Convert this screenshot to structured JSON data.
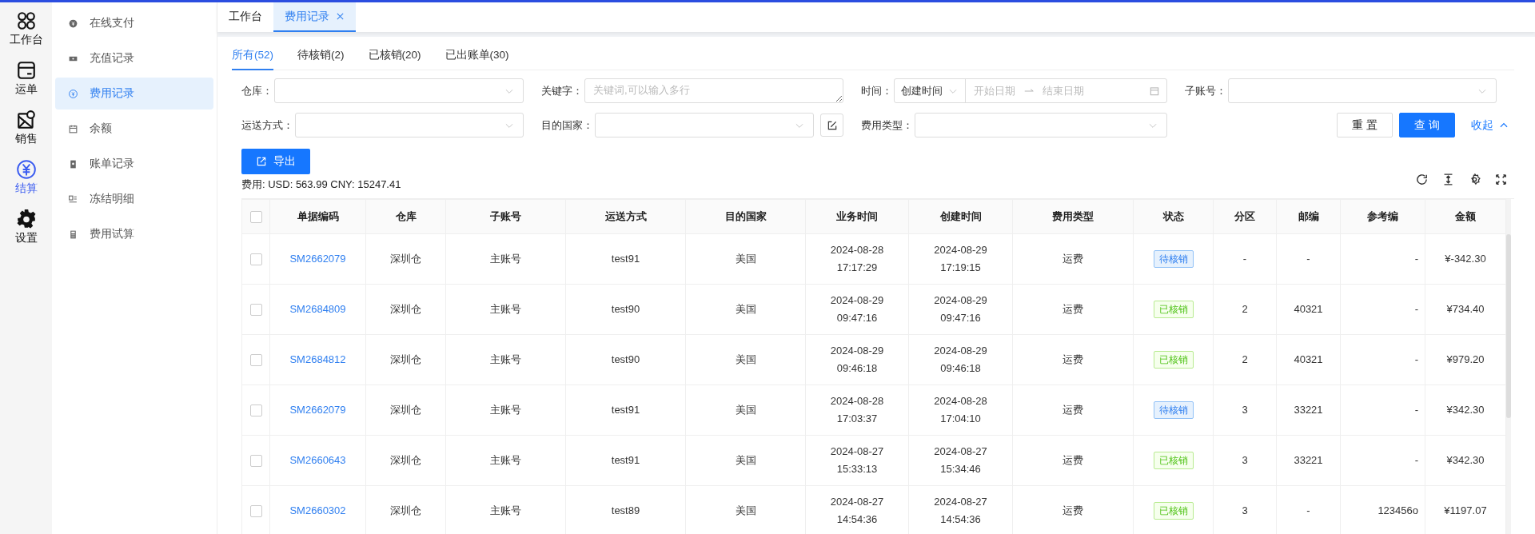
{
  "rail": {
    "items": [
      {
        "label": "工作台",
        "selected": false
      },
      {
        "label": "运单",
        "selected": false
      },
      {
        "label": "销售",
        "selected": false
      },
      {
        "label": "结算",
        "selected": true
      },
      {
        "label": "设置",
        "selected": false
      }
    ]
  },
  "submenu": {
    "items": [
      {
        "label": "在线支付",
        "selected": false
      },
      {
        "label": "充值记录",
        "selected": false
      },
      {
        "label": "费用记录",
        "selected": true
      },
      {
        "label": "余额",
        "selected": false
      },
      {
        "label": "账单记录",
        "selected": false
      },
      {
        "label": "冻结明细",
        "selected": false
      },
      {
        "label": "费用试算",
        "selected": false
      }
    ]
  },
  "page_tabs": [
    {
      "label": "工作台",
      "selected": false,
      "closable": false
    },
    {
      "label": "费用记录",
      "selected": true,
      "closable": true
    }
  ],
  "status_tabs": [
    {
      "label": "所有(52)",
      "selected": true
    },
    {
      "label": "待核销(2)",
      "selected": false
    },
    {
      "label": "已核销(20)",
      "selected": false
    },
    {
      "label": "已出账单(30)",
      "selected": false
    }
  ],
  "filters": [
    {
      "kind": "select",
      "label": "仓库："
    },
    {
      "kind": "textarea",
      "label": "关键字：",
      "placeholder": "关键词,可以输入多行"
    },
    {
      "kind": "daterange",
      "label": "时间：",
      "value": "创建时间",
      "start_placeholder": "开始日期",
      "end_placeholder": "结束日期"
    },
    {
      "kind": "select",
      "label": "子账号："
    },
    {
      "kind": "select",
      "label": "运送方式："
    },
    {
      "kind": "select_extra",
      "label": "目的国家："
    },
    {
      "kind": "select",
      "label": "费用类型："
    }
  ],
  "actions": {
    "reset": "重 置",
    "query": "查 询",
    "collapse": "收起"
  },
  "export_button": "导出",
  "summary": "费用: USD: 563.99 CNY: 15247.41",
  "table": {
    "all_checked": false,
    "columns": [
      "单据编码",
      "仓库",
      "子账号",
      "运送方式",
      "目的国家",
      "业务时间",
      "创建时间",
      "费用类型",
      "状态",
      "分区",
      "邮编",
      "参考编",
      "金额"
    ],
    "rows": [
      {
        "checked": false,
        "cells": [
          "SM2662079",
          "深圳仓",
          "主账号",
          "test91",
          "美国",
          "2024-08-28\n17:17:29",
          "2024-08-29\n17:19:15",
          "运费",
          {
            "label": "待核销",
            "kind": "pending"
          },
          "-",
          "-",
          "-",
          "¥-342.30"
        ]
      },
      {
        "checked": false,
        "cells": [
          "SM2684809",
          "深圳仓",
          "主账号",
          "test90",
          "美国",
          "2024-08-29\n09:47:16",
          "2024-08-29\n09:47:16",
          "运费",
          {
            "label": "已核销",
            "kind": "done"
          },
          "2",
          "40321",
          "-",
          "¥734.40"
        ]
      },
      {
        "checked": false,
        "cells": [
          "SM2684812",
          "深圳仓",
          "主账号",
          "test90",
          "美国",
          "2024-08-29\n09:46:18",
          "2024-08-29\n09:46:18",
          "运费",
          {
            "label": "已核销",
            "kind": "done"
          },
          "2",
          "40321",
          "-",
          "¥979.20"
        ]
      },
      {
        "checked": false,
        "cells": [
          "SM2662079",
          "深圳仓",
          "主账号",
          "test91",
          "美国",
          "2024-08-28\n17:03:37",
          "2024-08-28\n17:04:10",
          "运费",
          {
            "label": "待核销",
            "kind": "pending"
          },
          "3",
          "33221",
          "-",
          "¥342.30"
        ]
      },
      {
        "checked": false,
        "cells": [
          "SM2660643",
          "深圳仓",
          "主账号",
          "test91",
          "美国",
          "2024-08-27\n15:33:13",
          "2024-08-27\n15:34:46",
          "运费",
          {
            "label": "已核销",
            "kind": "done"
          },
          "3",
          "33221",
          "-",
          "¥342.30"
        ]
      },
      {
        "checked": false,
        "cells": [
          "SM2660302",
          "深圳仓",
          "主账号",
          "test89",
          "美国",
          "2024-08-27\n14:54:36",
          "2024-08-27\n14:54:36",
          "运费",
          {
            "label": "已核销",
            "kind": "done"
          },
          "3",
          "-",
          "123456o",
          "¥1197.07"
        ]
      }
    ]
  }
}
